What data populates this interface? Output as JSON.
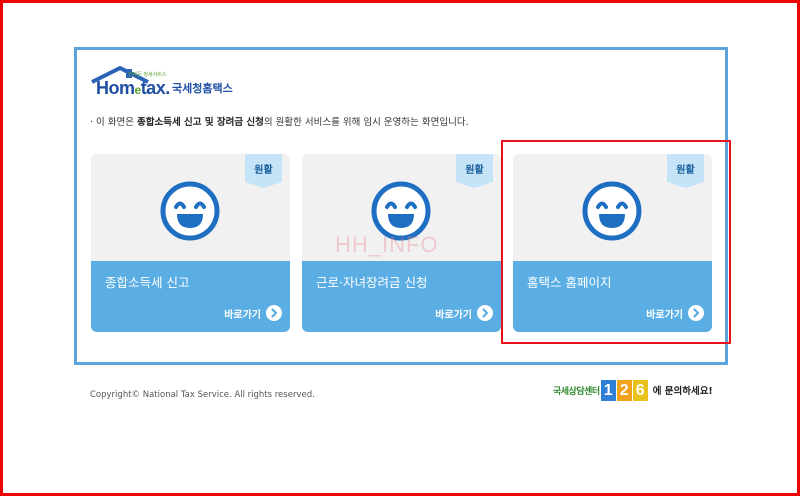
{
  "header": {
    "logo_brand_prefix": "Hom",
    "logo_brand_e": "e",
    "logo_brand_suffix": "tax.",
    "logo_tagline": "언제든 정세서비스",
    "logo_korean_name": "국세청홈택스"
  },
  "notice": {
    "prefix": "· 이 화면은 ",
    "bold_part": "종합소득세 신고 및 장려금 신청",
    "suffix": "의 원활한 서비스를 위해 임시 운영하는 화면입니다."
  },
  "cards": [
    {
      "status_badge": "원활",
      "title": "종합소득세 신고",
      "link_label": "바로가기"
    },
    {
      "status_badge": "원활",
      "title": "근로·자녀장려금 신청",
      "link_label": "바로가기"
    },
    {
      "status_badge": "원활",
      "title": "홈택스 홈페이지",
      "link_label": "바로가기"
    }
  ],
  "watermark": "HH_INFO",
  "footer": {
    "copyright": "Copyright© National Tax Service.  All rights reserved.",
    "contact_center": "국세상담센터",
    "phone_digits": [
      "1",
      "2",
      "6"
    ],
    "contact_suffix": "에 문의하세요!"
  },
  "colors": {
    "frame_red": "#f00000",
    "panel_border": "#5ba3dc",
    "card_blue": "#5aaee4",
    "smiley_blue": "#1e6fc2",
    "highlight_red": "#e8101a"
  }
}
